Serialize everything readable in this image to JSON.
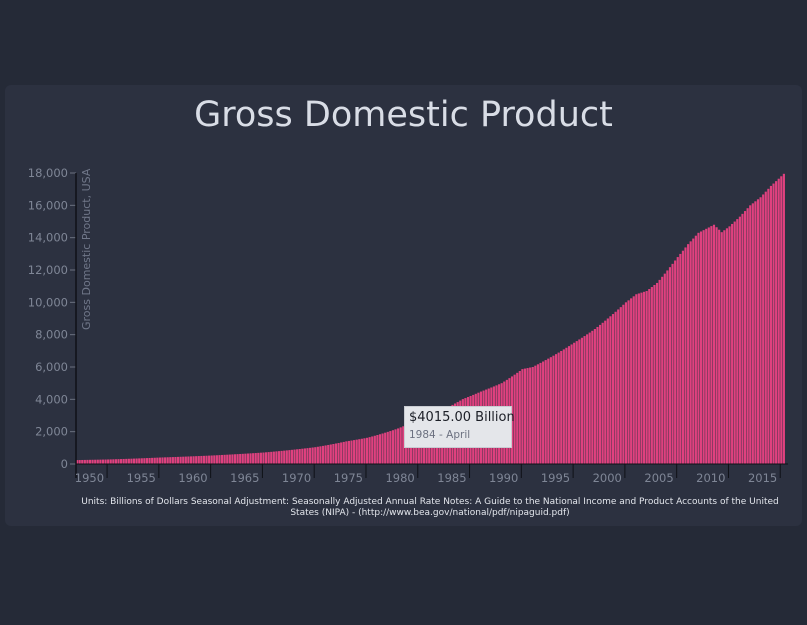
{
  "chart_data": {
    "type": "bar",
    "title": "Gross Domestic Product",
    "ylabel": "Gross Domestic Product, USA",
    "xlabel": "",
    "ylim": [
      0,
      18000
    ],
    "yticks": [
      "0",
      "2,000",
      "4,000",
      "6,000",
      "8,000",
      "10,000",
      "12,000",
      "14,000",
      "16,000",
      "18,000"
    ],
    "xticks": [
      "1950",
      "1955",
      "1960",
      "1965",
      "1970",
      "1975",
      "1980",
      "1985",
      "1990",
      "1995",
      "2000",
      "2005",
      "2010",
      "2015"
    ],
    "x_start_year": 1947,
    "frequency": "quarterly",
    "bar_color": "#e0417f",
    "anchors": [
      [
        1947.0,
        243
      ],
      [
        1950.0,
        280
      ],
      [
        1955.0,
        400
      ],
      [
        1960.0,
        526
      ],
      [
        1965.0,
        710
      ],
      [
        1970.0,
        1040
      ],
      [
        1973.0,
        1400
      ],
      [
        1975.0,
        1620
      ],
      [
        1978.0,
        2200
      ],
      [
        1980.0,
        2780
      ],
      [
        1982.0,
        3250
      ],
      [
        1984.25,
        4015
      ],
      [
        1986.0,
        4480
      ],
      [
        1988.0,
        5000
      ],
      [
        1990.0,
        5870
      ],
      [
        1991.0,
        6000
      ],
      [
        1993.0,
        6700
      ],
      [
        1995.0,
        7500
      ],
      [
        1997.0,
        8350
      ],
      [
        2000.0,
        10000
      ],
      [
        2001.0,
        10500
      ],
      [
        2002.0,
        10700
      ],
      [
        2003.0,
        11200
      ],
      [
        2005.0,
        12800
      ],
      [
        2006.0,
        13600
      ],
      [
        2007.0,
        14300
      ],
      [
        2008.5,
        14800
      ],
      [
        2009.25,
        14340
      ],
      [
        2010.0,
        14700
      ],
      [
        2011.0,
        15300
      ],
      [
        2012.0,
        16000
      ],
      [
        2013.0,
        16500
      ],
      [
        2014.0,
        17200
      ],
      [
        2015.25,
        17950
      ]
    ],
    "footnote": "Units: Billions of Dollars Seasonal Adjustment: Seasonally Adjusted Annual Rate Notes: A Guide to the National Income and Product Accounts of the United States (NIPA) - (http://www.bea.gov/national/pdf/nipaguid.pdf)",
    "tooltip": {
      "value": "$4015.00 Billion",
      "date": "1984 - April"
    }
  }
}
